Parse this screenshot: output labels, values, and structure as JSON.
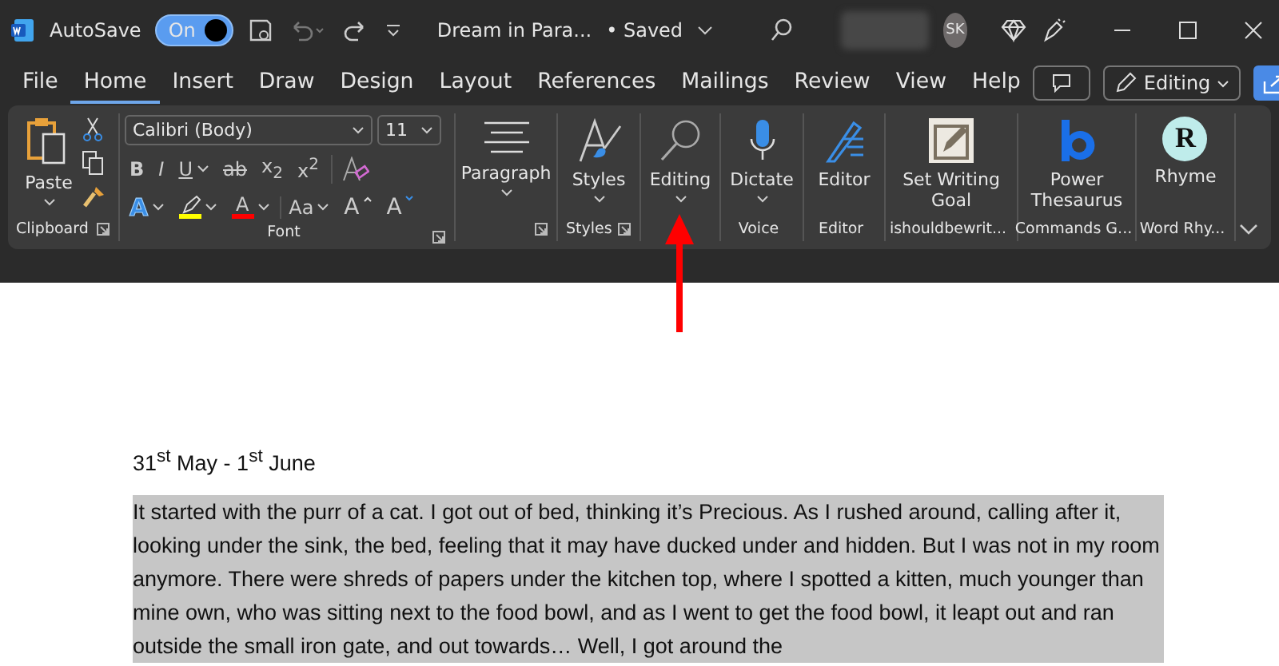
{
  "title_bar": {
    "autosave_label": "AutoSave",
    "autosave": {
      "label": "On",
      "on": true
    },
    "document_title": "Dream in Para...",
    "save_status": "• Saved",
    "avatar_initials": "SK"
  },
  "tabs": [
    {
      "label": "File",
      "selected": false
    },
    {
      "label": "Home",
      "selected": true
    },
    {
      "label": "Insert",
      "selected": false
    },
    {
      "label": "Draw",
      "selected": false
    },
    {
      "label": "Design",
      "selected": false
    },
    {
      "label": "Layout",
      "selected": false
    },
    {
      "label": "References",
      "selected": false
    },
    {
      "label": "Mailings",
      "selected": false
    },
    {
      "label": "Review",
      "selected": false
    },
    {
      "label": "View",
      "selected": false
    },
    {
      "label": "Help",
      "selected": false
    }
  ],
  "tab_actions": {
    "editing_mode": "Editing"
  },
  "ribbon": {
    "groups": [
      {
        "kind": "clipboard",
        "label": "Clipboard",
        "launcher": true,
        "paste": "Paste"
      },
      {
        "kind": "font",
        "label": "Font",
        "launcher": true,
        "font_name": "Calibri (Body)",
        "font_size": "11",
        "format_buttons": [
          {
            "label": "B",
            "dropdown": false
          },
          {
            "label": "I",
            "dropdown": false
          },
          {
            "label": "U",
            "dropdown": true
          },
          {
            "label": "ab",
            "dropdown": false
          },
          {
            "label": "x$_{2}$",
            "dropdown": false
          },
          {
            "label": "x$^{2}$",
            "dropdown": false
          }
        ],
        "color_buttons": [
          {
            "kind": "effects",
            "label": "A",
            "color": "#3a8ee6"
          },
          {
            "kind": "highlight",
            "color": "#ffff00"
          },
          {
            "kind": "font_color",
            "label": "A",
            "color": "#ff0000"
          },
          {
            "kind": "case",
            "label": "Aa"
          },
          {
            "kind": "grow",
            "label": "A"
          },
          {
            "kind": "shrink",
            "label": "A"
          }
        ]
      },
      {
        "kind": "buttons",
        "launcher": true,
        "buttons": [
          {
            "kind": "paragraph",
            "label": "Paragraph",
            "dropdown": true
          }
        ]
      },
      {
        "kind": "buttons",
        "label": "Styles",
        "launcher": true,
        "buttons": [
          {
            "kind": "styles",
            "label": "Styles",
            "dropdown": true
          }
        ]
      },
      {
        "kind": "buttons",
        "launcher": false,
        "buttons": [
          {
            "kind": "editing",
            "label": "Editing",
            "dropdown": true
          }
        ]
      },
      {
        "kind": "buttons",
        "label": "Voice",
        "launcher": false,
        "buttons": [
          {
            "kind": "dictate",
            "label": "Dictate",
            "dropdown": true
          }
        ]
      },
      {
        "kind": "buttons",
        "label": "Editor",
        "launcher": false,
        "buttons": [
          {
            "kind": "editor",
            "label": "Editor",
            "dropdown": false
          }
        ]
      },
      {
        "kind": "buttons",
        "label": "ishouldbewrit...",
        "launcher": false,
        "buttons": [
          {
            "kind": "goal",
            "label": "Set Writing Goal",
            "dropdown": false
          }
        ]
      },
      {
        "kind": "buttons",
        "label": "Commands G...",
        "launcher": false,
        "buttons": [
          {
            "kind": "thesaurus",
            "label": "Power Thesaurus",
            "dropdown": false
          }
        ]
      },
      {
        "kind": "buttons",
        "label": "Word Rhy...",
        "launcher": false,
        "buttons": [
          {
            "kind": "rhyme",
            "label": "Rhyme",
            "icon_text": "R",
            "dropdown": false
          }
        ]
      }
    ]
  },
  "document": {
    "date": "31$^{st}$ May - 1$^{st}$ June",
    "paragraph": "It started with the purr of a cat. I got out of bed, thinking it’s Precious. As I rushed around, calling after it, looking under the sink, the bed, feeling that it may have ducked under and hidden. But I was not in my room anymore. There were shreds of papers under the kitchen top, where I spotted a kitten, much younger than mine own, who was sitting next to the food bowl, and as I went to get the food bowl, it leapt out and ran outside the small iron gate, and out towards… Well, I got around the",
    "paragraph_selected": true
  }
}
